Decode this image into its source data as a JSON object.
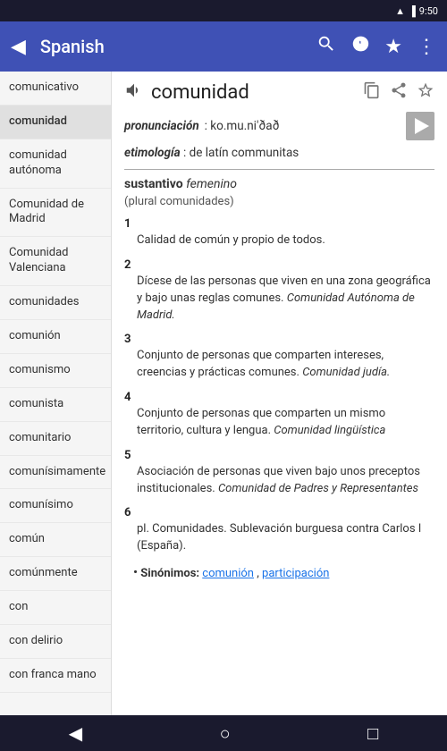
{
  "statusBar": {
    "time": "9:50",
    "icons": [
      "wifi",
      "battery"
    ]
  },
  "topBar": {
    "title": "Spanish",
    "backIcon": "◀",
    "searchIcon": "🔍",
    "historyIcon": "🕐",
    "starIcon": "★",
    "moreIcon": "⋮"
  },
  "sidebar": {
    "items": [
      {
        "label": "comunicativo",
        "active": false
      },
      {
        "label": "comunidad",
        "active": true
      },
      {
        "label": "comunidad autónoma",
        "active": false
      },
      {
        "label": "Comunidad de Madrid",
        "active": false
      },
      {
        "label": "Comunidad Valenciana",
        "active": false
      },
      {
        "label": "comunidades",
        "active": false
      },
      {
        "label": "comunión",
        "active": false
      },
      {
        "label": "comunismo",
        "active": false
      },
      {
        "label": "comunista",
        "active": false
      },
      {
        "label": "comunitario",
        "active": false
      },
      {
        "label": "comunísimamente",
        "active": false
      },
      {
        "label": "comunísimo",
        "active": false
      },
      {
        "label": "común",
        "active": false
      },
      {
        "label": "comúnmente",
        "active": false
      },
      {
        "label": "con",
        "active": false
      },
      {
        "label": "con delirio",
        "active": false
      },
      {
        "label": "con franca mano",
        "active": false
      }
    ]
  },
  "content": {
    "word": "comunidad",
    "headerIcons": [
      "copy",
      "share",
      "star"
    ],
    "pronunciation": {
      "label": "pronunciación",
      "value": ": ko.mu.ni'ðað"
    },
    "etymology": {
      "label": "etimología",
      "value": ": de latín communitas"
    },
    "pos": {
      "label": "sustantivo",
      "gender": "femenino"
    },
    "plural": "(plural comunidades)",
    "definitions": [
      {
        "number": "1",
        "text": "Calidad de común y propio de todos.",
        "example": ""
      },
      {
        "number": "2",
        "text": "Dícese de las personas que viven en una zona geográfica y bajo unas reglas comunes.",
        "example": "Comunidad Autónoma de Madrid."
      },
      {
        "number": "3",
        "text": "Conjunto de personas que comparten intereses, creencias y prácticas comunes.",
        "example": "Comunidad judía."
      },
      {
        "number": "4",
        "text": "Conjunto de personas que comparten un mismo territorio, cultura y lengua.",
        "example": "Comunidad lingüística"
      },
      {
        "number": "5",
        "text": "Asociación de personas que viven bajo unos preceptos institucionales.",
        "example": "Comunidad de Padres y Representantes"
      },
      {
        "number": "6",
        "text": "pl. Comunidades. Sublevación burguesa contra Carlos I (España).",
        "example": ""
      }
    ],
    "synonyms": {
      "label": "Sinónimos:",
      "items": [
        "comunión",
        "participación"
      ]
    }
  },
  "bottomNav": {
    "backBtn": "◀",
    "homeBtn": "○",
    "recentBtn": "□"
  }
}
